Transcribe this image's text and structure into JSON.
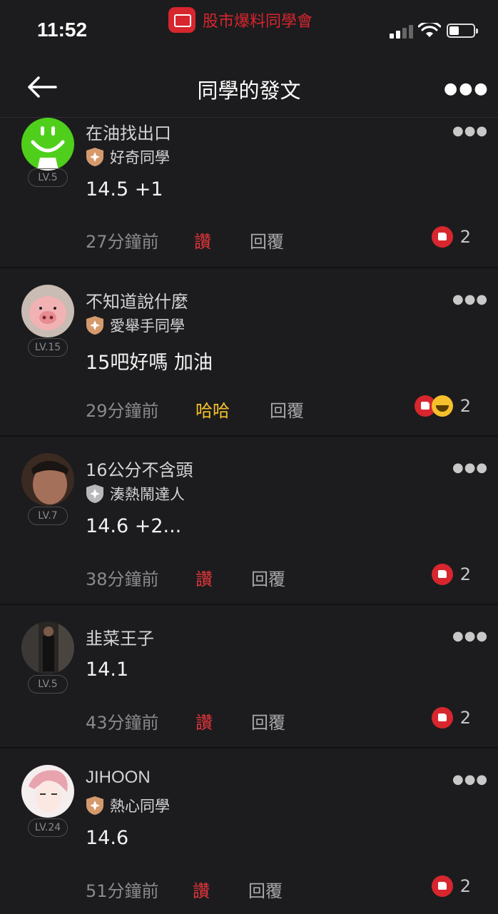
{
  "status_bar": {
    "time": "11:52",
    "app_name": "股市爆料同學會",
    "battery_percent": 40
  },
  "header": {
    "title": "同學的發文",
    "back_icon": "back-arrow-icon",
    "more_icon": "more-icon"
  },
  "posts": [
    {
      "name": "在油找出口",
      "level": "LV.5",
      "badge": "好奇同學",
      "badge_color": "#d59a6c",
      "content": "14.5 +1",
      "time_ago": "27分鐘前",
      "action": "讚",
      "action_color": "#e0353b",
      "reply": "回覆",
      "reactions": [
        "like"
      ],
      "reaction_count": "2",
      "avatar": "smiley"
    },
    {
      "name": "不知道說什麼",
      "level": "LV.15",
      "badge": "愛舉手同學",
      "badge_color": "#d59a6c",
      "content": "15吧好嗎 加油",
      "time_ago": "29分鐘前",
      "action": "哈哈",
      "action_color": "#f5c02c",
      "reply": "回覆",
      "reactions": [
        "like",
        "haha"
      ],
      "reaction_count": "2",
      "avatar": "pig"
    },
    {
      "name": "16公分不含頭",
      "level": "LV.7",
      "badge": "湊熱鬧達人",
      "badge_color": "#b8b8bc",
      "content": "14.6 +2...",
      "time_ago": "38分鐘前",
      "action": "讚",
      "action_color": "#e0353b",
      "reply": "回覆",
      "reactions": [
        "like"
      ],
      "reaction_count": "2",
      "avatar": "man"
    },
    {
      "name": "韭菜王子",
      "level": "LV.5",
      "badge": "",
      "content": "14.1",
      "time_ago": "43分鐘前",
      "action": "讚",
      "action_color": "#e0353b",
      "reply": "回覆",
      "reactions": [
        "like"
      ],
      "reaction_count": "2",
      "avatar": "suit"
    },
    {
      "name": "JIHOON",
      "level": "LV.24",
      "badge": "熱心同學",
      "badge_color": "#d59a6c",
      "content": "14.6",
      "time_ago": "51分鐘前",
      "action": "讚",
      "action_color": "#e0353b",
      "reply": "回覆",
      "reactions": [
        "like"
      ],
      "reaction_count": "2",
      "avatar": "anime"
    }
  ]
}
